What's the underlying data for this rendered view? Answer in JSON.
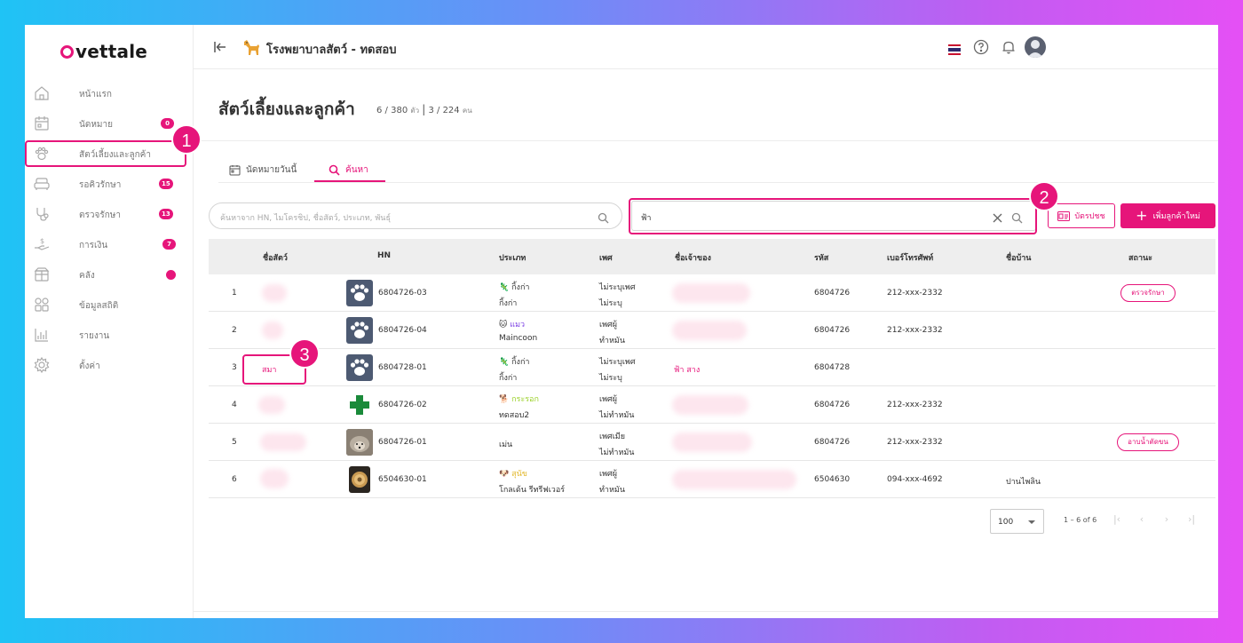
{
  "brand": {
    "logo_text": "vettale",
    "accent": "#e6157a"
  },
  "header": {
    "hospital_name": "โรงพยาบาลสัตว์ - ทดสอบ"
  },
  "sidebar": {
    "items": [
      {
        "label": "หน้าแรก",
        "icon": "home-icon",
        "badge": ""
      },
      {
        "label": "นัดหมาย",
        "icon": "calendar-icon",
        "badge": "0"
      },
      {
        "label": "สัตว์เลี้ยงและลูกค้า",
        "icon": "paw-icon",
        "badge": ""
      },
      {
        "label": "รอคิวรักษา",
        "icon": "sofa-icon",
        "badge": "15"
      },
      {
        "label": "ตรวจรักษา",
        "icon": "stethoscope-icon",
        "badge": "13"
      },
      {
        "label": "การเงิน",
        "icon": "money-hand-icon",
        "badge": "7"
      },
      {
        "label": "คลัง",
        "icon": "box-icon",
        "badge": ""
      },
      {
        "label": "ข้อมูลสถิติ",
        "icon": "grid-icon",
        "badge": ""
      },
      {
        "label": "รายงาน",
        "icon": "bar-chart-icon",
        "badge": ""
      },
      {
        "label": "ตั้งค่า",
        "icon": "gear-icon",
        "badge": ""
      }
    ]
  },
  "page": {
    "title": "สัตว์เลี้ยงและลูกค้า",
    "pet_count": "6 / 380",
    "pet_unit": "ตัว",
    "owner_count": "3 / 224",
    "owner_unit": "คน"
  },
  "tabs": [
    {
      "label": "นัดหมายวันนี้",
      "icon": "calendar-icon"
    },
    {
      "label": "ค้นหา",
      "icon": "search-icon"
    }
  ],
  "search": {
    "main_placeholder": "ค้นหาจาก HN, ไมโครชิป, ชื่อสัตว์, ประเภท, พันธุ์",
    "owner_value": "ฟ้า"
  },
  "buttons": {
    "id_card": "บัตรปชช",
    "add_customer": "เพิ่มลูกค้าใหม่"
  },
  "annotations": {
    "marker1": "1",
    "marker2": "2",
    "marker3": "3"
  },
  "table": {
    "headers": [
      "ชื่อสัตว์",
      "HN",
      "ประเภท",
      "เพศ",
      "ชื่อเจ้าของ",
      "รหัส",
      "เบอร์โทรศัพท์",
      "ชื่อบ้าน",
      "สถานะ"
    ],
    "rows": [
      {
        "no": "1",
        "pet_name": "",
        "hn": "6804726-03",
        "type_emoji": "🦎",
        "type": "กิ้งก่า",
        "breed": "กิ้งก่า",
        "sex": "ไม่ระบุเพศ",
        "neuter": "ไม่ระบุ",
        "owner": "",
        "code": "6804726",
        "phone": "212-xxx-2332",
        "house": "",
        "status": "ตรวจรักษา"
      },
      {
        "no": "2",
        "pet_name": "",
        "hn": "6804726-04",
        "type_emoji": "🐱",
        "type": "แมว",
        "breed": "Maincoon",
        "sex": "เพศผู้",
        "neuter": "ทำหมัน",
        "owner": "",
        "code": "6804726",
        "phone": "212-xxx-2332",
        "house": "",
        "status": ""
      },
      {
        "no": "3",
        "pet_name": "สมา",
        "hn": "6804728-01",
        "type_emoji": "🦎",
        "type": "กิ้งก่า",
        "breed": "กิ้งก่า",
        "sex": "ไม่ระบุเพศ",
        "neuter": "ไม่ระบุ",
        "owner": "ฟ้า สาง",
        "code": "6804728",
        "phone": "",
        "house": "",
        "status": ""
      },
      {
        "no": "4",
        "pet_name": "",
        "hn": "6804726-02",
        "type_emoji": "🐕",
        "type": "กระรอก",
        "breed": "ทดสอบ2",
        "sex": "เพศผู้",
        "neuter": "ไม่ทำหมัน",
        "owner": "",
        "code": "6804726",
        "phone": "212-xxx-2332",
        "house": "",
        "status": ""
      },
      {
        "no": "5",
        "pet_name": "",
        "hn": "6804726-01",
        "type_emoji": "",
        "type": "",
        "breed": "เม่น",
        "sex": "เพศเมีย",
        "neuter": "ไม่ทำหมัน",
        "owner": "",
        "code": "6804726",
        "phone": "212-xxx-2332",
        "house": "",
        "status": "อาบน้ำตัดขน"
      },
      {
        "no": "6",
        "pet_name": "",
        "hn": "6504630-01",
        "type_emoji": "🐶",
        "type": "สุนัข",
        "breed": "โกลเด้น รีทรีฟเวอร์",
        "sex": "เพศผู้",
        "neuter": "ทำหมัน",
        "owner": "",
        "code": "6504630",
        "phone": "094-xxx-4692",
        "house": "ปานไพลิน",
        "status": ""
      }
    ]
  },
  "pagination": {
    "page_size": "100",
    "range": "1 – 6 of 6"
  }
}
